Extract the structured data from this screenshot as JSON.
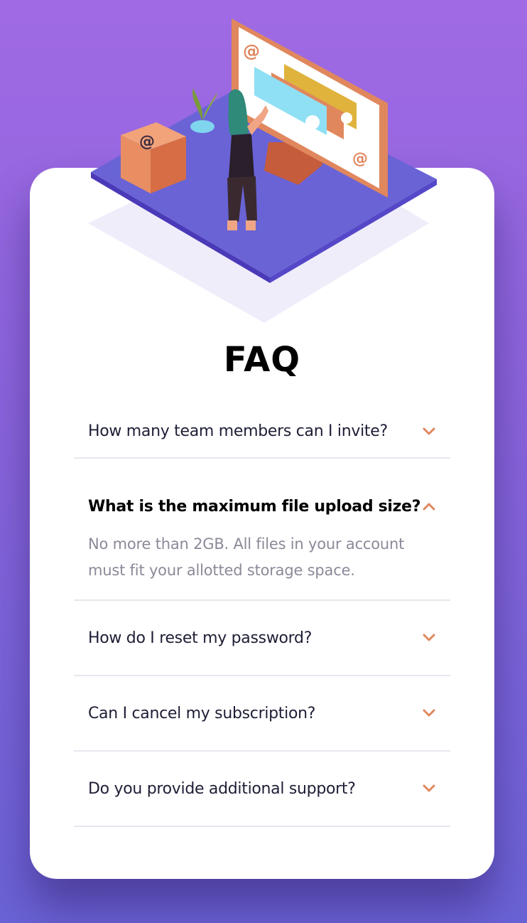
{
  "title": "FAQ",
  "faqs": [
    {
      "question": "How many team members can I invite?",
      "open": false
    },
    {
      "question": "What is the maximum file upload size?",
      "open": true,
      "answer": "No more than 2GB. All files in your account must fit your allotted storage space."
    },
    {
      "question": "How do I reset my password?",
      "open": false
    },
    {
      "question": "Can I cancel my subscription?",
      "open": false
    },
    {
      "question": "Do you provide additional support?",
      "open": false
    }
  ],
  "colors": {
    "accent": "#e0875e",
    "platform": "#6564e0",
    "text": "#1d1e35",
    "muted": "#8a8a99"
  }
}
